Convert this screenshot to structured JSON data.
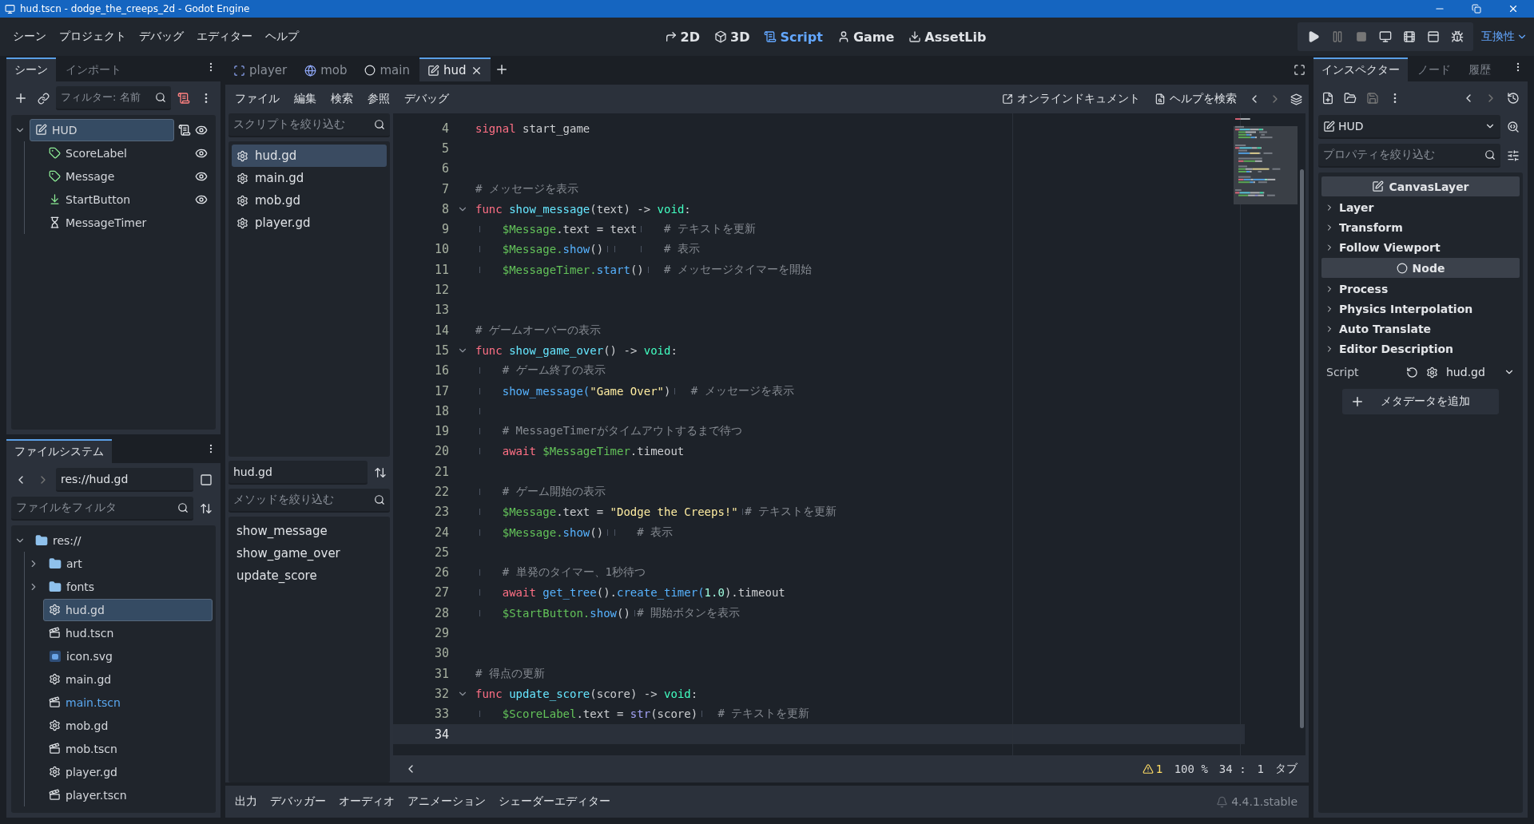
{
  "window": {
    "title": "hud.tscn - dodge_the_creeps_2d - Godot Engine"
  },
  "menu": [
    "シーン",
    "プロジェクト",
    "デバッグ",
    "エディター",
    "ヘルプ"
  ],
  "workspaces": [
    {
      "kind": "planar",
      "label": "2D",
      "selected": false
    },
    {
      "kind": "spatial",
      "label": "3D",
      "selected": false
    },
    {
      "kind": "script",
      "label": "Script",
      "selected": true
    },
    {
      "kind": "game",
      "label": "Game",
      "selected": false
    },
    {
      "kind": "assetlib",
      "label": "AssetLib",
      "selected": false
    }
  ],
  "renderer": "互換性",
  "scene_dock": {
    "tabs": [
      {
        "label": "シーン",
        "selected": true
      },
      {
        "label": "インポート",
        "selected": false
      }
    ],
    "filter": {
      "placeholder": "フィルター: 名前"
    },
    "tree": [
      {
        "name": "HUD",
        "kind": "canvas",
        "selected": true,
        "expanded": true,
        "script": true,
        "visible": true,
        "children": [
          {
            "name": "ScoreLabel",
            "kind": "label",
            "selected": false,
            "script": false,
            "visible": true
          },
          {
            "name": "Message",
            "kind": "label",
            "selected": false,
            "script": false,
            "visible": true
          },
          {
            "name": "StartButton",
            "kind": "button",
            "selected": false,
            "script": false,
            "visible": true
          },
          {
            "name": "MessageTimer",
            "kind": "timer",
            "selected": false,
            "script": false
          }
        ]
      }
    ]
  },
  "filesystem": {
    "tab": "ファイルシステム",
    "path": "res://hud.gd",
    "filter": {
      "placeholder": "ファイルをフィルタ"
    },
    "tree": [
      {
        "name": "res://",
        "kind": "folder",
        "expanded": true,
        "selected": false,
        "children": [
          {
            "name": "art",
            "kind": "folder",
            "expanded": false,
            "selected": false
          },
          {
            "name": "fonts",
            "kind": "folder",
            "expanded": false,
            "selected": false
          },
          {
            "name": "hud.gd",
            "kind": "script",
            "selected": true,
            "main_scene": false
          },
          {
            "name": "hud.tscn",
            "kind": "scene",
            "selected": false,
            "main_scene": false
          },
          {
            "name": "icon.svg",
            "kind": "image",
            "selected": false,
            "main_scene": false
          },
          {
            "name": "main.gd",
            "kind": "script",
            "selected": false,
            "main_scene": false
          },
          {
            "name": "main.tscn",
            "kind": "scene",
            "selected": false,
            "main_scene": true
          },
          {
            "name": "mob.gd",
            "kind": "script",
            "selected": false,
            "main_scene": false
          },
          {
            "name": "mob.tscn",
            "kind": "scene",
            "selected": false,
            "main_scene": false
          },
          {
            "name": "player.gd",
            "kind": "script",
            "selected": false,
            "main_scene": false
          },
          {
            "name": "player.tscn",
            "kind": "scene",
            "selected": false,
            "main_scene": false
          }
        ]
      }
    ]
  },
  "script_editor": {
    "tabs": [
      {
        "label": "player",
        "kind": "node2d",
        "selected": false
      },
      {
        "label": "mob",
        "kind": "rigid",
        "selected": false
      },
      {
        "label": "main",
        "kind": "node",
        "selected": false
      },
      {
        "label": "hud",
        "kind": "canvas",
        "selected": true
      }
    ],
    "menu": [
      "ファイル",
      "編集",
      "検索",
      "参照",
      "デバッグ"
    ],
    "help": [
      "オンラインドキュメント",
      "ヘルプを検索"
    ],
    "script_filter": {
      "placeholder": "スクリプトを絞り込む"
    },
    "scripts": [
      {
        "name": "hud.gd",
        "selected": true
      },
      {
        "name": "main.gd",
        "selected": false
      },
      {
        "name": "mob.gd",
        "selected": false
      },
      {
        "name": "player.gd",
        "selected": false
      }
    ],
    "current_script": "hud.gd",
    "method_filter": {
      "placeholder": "メソッドを絞り込む"
    },
    "methods": [
      "show_message",
      "show_game_over",
      "update_score"
    ],
    "code": [
      {
        "number": "4",
        "foldable": false,
        "selected": false,
        "tokens": [
          {
            "kind": "keyword",
            "text": "signal"
          },
          {
            "kind": "plain",
            "text": " start_game"
          }
        ]
      },
      {
        "number": "5",
        "foldable": false,
        "selected": false
      },
      {
        "number": "6",
        "foldable": false,
        "selected": false
      },
      {
        "number": "7",
        "foldable": false,
        "selected": false,
        "tokens": [
          {
            "kind": "comment",
            "text": "# メッセージを表示"
          }
        ]
      },
      {
        "number": "8",
        "foldable": true,
        "selected": false,
        "tokens": [
          {
            "kind": "keyword",
            "text": "func "
          },
          {
            "kind": "definition",
            "text": "show_message"
          },
          {
            "kind": "plain",
            "text": "(text) -> "
          },
          {
            "kind": "type",
            "text": "void"
          },
          {
            "kind": "plain",
            "text": ":"
          }
        ]
      },
      {
        "number": "9",
        "foldable": false,
        "selected": false,
        "tokens": [
          {
            "kind": "tab"
          },
          {
            "kind": "node",
            "text": "$Message"
          },
          {
            "kind": "plain",
            "text": ".text = text"
          },
          {
            "kind": "tab"
          },
          {
            "kind": "comment",
            "text": "# テキストを更新"
          }
        ]
      },
      {
        "number": "10",
        "foldable": false,
        "selected": false,
        "tokens": [
          {
            "kind": "tab"
          },
          {
            "kind": "node",
            "text": "$Message."
          },
          {
            "kind": "call",
            "text": "show"
          },
          {
            "kind": "plain",
            "text": "()"
          },
          {
            "kind": "tab"
          },
          {
            "kind": "tab"
          },
          {
            "kind": "tab"
          },
          {
            "kind": "comment",
            "text": "# 表示"
          }
        ]
      },
      {
        "number": "11",
        "foldable": false,
        "selected": false,
        "tokens": [
          {
            "kind": "tab"
          },
          {
            "kind": "node",
            "text": "$MessageTimer."
          },
          {
            "kind": "call",
            "text": "start"
          },
          {
            "kind": "plain",
            "text": "()"
          },
          {
            "kind": "tab"
          },
          {
            "kind": "comment",
            "text": "# メッセージタイマーを開始"
          }
        ]
      },
      {
        "number": "12",
        "foldable": false,
        "selected": false
      },
      {
        "number": "13",
        "foldable": false,
        "selected": false
      },
      {
        "number": "14",
        "foldable": false,
        "selected": false,
        "tokens": [
          {
            "kind": "comment",
            "text": "# ゲームオーバーの表示"
          }
        ]
      },
      {
        "number": "15",
        "foldable": true,
        "selected": false,
        "tokens": [
          {
            "kind": "keyword",
            "text": "func "
          },
          {
            "kind": "definition",
            "text": "show_game_over"
          },
          {
            "kind": "plain",
            "text": "() -> "
          },
          {
            "kind": "type",
            "text": "void"
          },
          {
            "kind": "plain",
            "text": ":"
          }
        ]
      },
      {
        "number": "16",
        "foldable": false,
        "selected": false,
        "tokens": [
          {
            "kind": "tab"
          },
          {
            "kind": "comment",
            "text": "# ゲーム終了の表示"
          }
        ]
      },
      {
        "number": "17",
        "foldable": false,
        "selected": false,
        "tokens": [
          {
            "kind": "tab"
          },
          {
            "kind": "call",
            "text": "show_message("
          },
          {
            "kind": "string",
            "text": "\"Game Over\""
          },
          {
            "kind": "plain",
            "text": ")"
          },
          {
            "kind": "tab"
          },
          {
            "kind": "comment",
            "text": "# メッセージを表示"
          }
        ]
      },
      {
        "number": "18",
        "foldable": false,
        "selected": false,
        "tokens": [
          {
            "kind": "tab"
          }
        ]
      },
      {
        "number": "19",
        "foldable": false,
        "selected": false,
        "tokens": [
          {
            "kind": "tab"
          },
          {
            "kind": "comment",
            "text": "# MessageTimerがタイムアウトするまで待つ"
          }
        ]
      },
      {
        "number": "20",
        "foldable": false,
        "selected": false,
        "tokens": [
          {
            "kind": "tab"
          },
          {
            "kind": "keyword",
            "text": "await "
          },
          {
            "kind": "node",
            "text": "$MessageTimer"
          },
          {
            "kind": "plain",
            "text": ".timeout"
          }
        ]
      },
      {
        "number": "21",
        "foldable": false,
        "selected": false
      },
      {
        "number": "22",
        "foldable": false,
        "selected": false,
        "tokens": [
          {
            "kind": "tab"
          },
          {
            "kind": "comment",
            "text": "# ゲーム開始の表示"
          }
        ]
      },
      {
        "number": "23",
        "foldable": false,
        "selected": false,
        "tokens": [
          {
            "kind": "tab"
          },
          {
            "kind": "node",
            "text": "$Message"
          },
          {
            "kind": "plain",
            "text": ".text = "
          },
          {
            "kind": "string",
            "text": "\"Dodge the Creeps!\""
          },
          {
            "kind": "tab"
          },
          {
            "kind": "comment",
            "text": "# テキストを更新"
          }
        ]
      },
      {
        "number": "24",
        "foldable": false,
        "selected": false,
        "tokens": [
          {
            "kind": "tab"
          },
          {
            "kind": "node",
            "text": "$Message."
          },
          {
            "kind": "call",
            "text": "show"
          },
          {
            "kind": "plain",
            "text": "()"
          },
          {
            "kind": "tab"
          },
          {
            "kind": "tab"
          },
          {
            "kind": "comment",
            "text": "# 表示"
          }
        ]
      },
      {
        "number": "25",
        "foldable": false,
        "selected": false
      },
      {
        "number": "26",
        "foldable": false,
        "selected": false,
        "tokens": [
          {
            "kind": "tab"
          },
          {
            "kind": "comment",
            "text": "# 単発のタイマー、1秒待つ"
          }
        ]
      },
      {
        "number": "27",
        "foldable": false,
        "selected": false,
        "tokens": [
          {
            "kind": "tab"
          },
          {
            "kind": "keyword",
            "text": "await "
          },
          {
            "kind": "call",
            "text": "get_tree"
          },
          {
            "kind": "plain",
            "text": "()."
          },
          {
            "kind": "call",
            "text": "create_timer("
          },
          {
            "kind": "number",
            "text": "1.0"
          },
          {
            "kind": "plain",
            "text": ").timeout"
          }
        ]
      },
      {
        "number": "28",
        "foldable": false,
        "selected": false,
        "tokens": [
          {
            "kind": "tab"
          },
          {
            "kind": "node",
            "text": "$StartButton."
          },
          {
            "kind": "call",
            "text": "show"
          },
          {
            "kind": "plain",
            "text": "()"
          },
          {
            "kind": "tab"
          },
          {
            "kind": "comment",
            "text": "# 開始ボタンを表示"
          }
        ]
      },
      {
        "number": "29",
        "foldable": false,
        "selected": false
      },
      {
        "number": "30",
        "foldable": false,
        "selected": false
      },
      {
        "number": "31",
        "foldable": false,
        "selected": false,
        "tokens": [
          {
            "kind": "comment",
            "text": "# 得点の更新"
          }
        ]
      },
      {
        "number": "32",
        "foldable": true,
        "selected": false,
        "tokens": [
          {
            "kind": "keyword",
            "text": "func "
          },
          {
            "kind": "definition",
            "text": "update_score"
          },
          {
            "kind": "plain",
            "text": "(score) -> "
          },
          {
            "kind": "type",
            "text": "void"
          },
          {
            "kind": "plain",
            "text": ":"
          }
        ]
      },
      {
        "number": "33",
        "foldable": false,
        "selected": false,
        "tokens": [
          {
            "kind": "tab"
          },
          {
            "kind": "node",
            "text": "$ScoreLabel"
          },
          {
            "kind": "plain",
            "text": ".text = "
          },
          {
            "kind": "builtin",
            "text": "str"
          },
          {
            "kind": "plain",
            "text": "(score)"
          },
          {
            "kind": "tab"
          },
          {
            "kind": "comment",
            "text": "# テキストを更新"
          }
        ]
      },
      {
        "number": "34",
        "foldable": false,
        "selected": true
      }
    ],
    "status": {
      "warnings": "1",
      "zoom": "100 %",
      "line": "34 :",
      "column": "1",
      "indent": "タブ"
    }
  },
  "bottom_panel": {
    "tabs": [
      "出力",
      "デバッガー",
      "オーディオ",
      "アニメーション",
      "シェーダーエディター"
    ],
    "version": "4.4.1.stable"
  },
  "inspector": {
    "tabs": [
      {
        "label": "インスペクター",
        "selected": true
      },
      {
        "label": "ノード",
        "selected": false
      },
      {
        "label": "履歴",
        "selected": false
      }
    ],
    "object": "HUD",
    "filter": {
      "placeholder": "プロパティを絞り込む"
    },
    "sections": [
      {
        "kind": "canvas_layer",
        "label": "CanvasLayer"
      },
      {
        "kind": "group",
        "label": "Layer"
      },
      {
        "kind": "group",
        "label": "Transform"
      },
      {
        "kind": "group",
        "label": "Follow Viewport"
      },
      {
        "kind": "node",
        "label": "Node"
      },
      {
        "kind": "group",
        "label": "Process"
      },
      {
        "kind": "group",
        "label": "Physics Interpolation"
      },
      {
        "kind": "group",
        "label": "Auto Translate"
      },
      {
        "kind": "group",
        "label": "Editor Description"
      }
    ],
    "script": {
      "label": "Script",
      "value": "hud.gd"
    },
    "add_metadata": "メタデータを追加"
  }
}
